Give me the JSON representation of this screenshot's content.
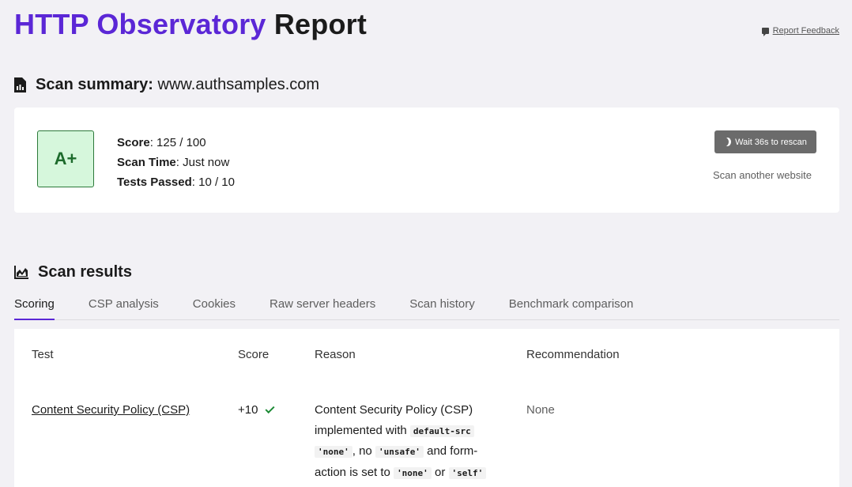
{
  "header": {
    "title_accent": "HTTP Observatory",
    "title_rest": "Report",
    "feedback_label": "Report Feedback"
  },
  "summary": {
    "heading_label": "Scan summary:",
    "site": "www.authsamples.com",
    "grade": "A+",
    "score_label": "Score",
    "score_value": ": 125 / 100",
    "time_label": "Scan Time",
    "time_value": ": Just now",
    "tests_label": "Tests Passed",
    "tests_value": ": 10 / 10",
    "rescan_label": "Wait 36s to rescan",
    "another_label": "Scan another website"
  },
  "results": {
    "heading": "Scan results",
    "tabs": [
      "Scoring",
      "CSP analysis",
      "Cookies",
      "Raw server headers",
      "Scan history",
      "Benchmark comparison"
    ],
    "columns": [
      "Test",
      "Score",
      "Reason",
      "Recommendation"
    ],
    "rows": [
      {
        "test": "Content Security Policy (CSP)",
        "score": "+10",
        "reason_1": "Content Security Policy (CSP) implemented with",
        "reason_code_1": "default-src",
        "reason_code_2": "'none'",
        "reason_2": ", no",
        "reason_code_3": "'unsafe'",
        "reason_3": "and form-action is set to",
        "reason_code_4": "'none'",
        "reason_4": "or",
        "reason_code_5": "'self'",
        "recommendation": "None"
      }
    ]
  },
  "colors": {
    "accent": "#5b27d6",
    "grade_bg": "#d6f7dc",
    "pass_green": "#1c8a35"
  },
  "icons": [
    "feedback-icon",
    "document-icon",
    "moon-icon",
    "chart-icon",
    "check-icon"
  ]
}
